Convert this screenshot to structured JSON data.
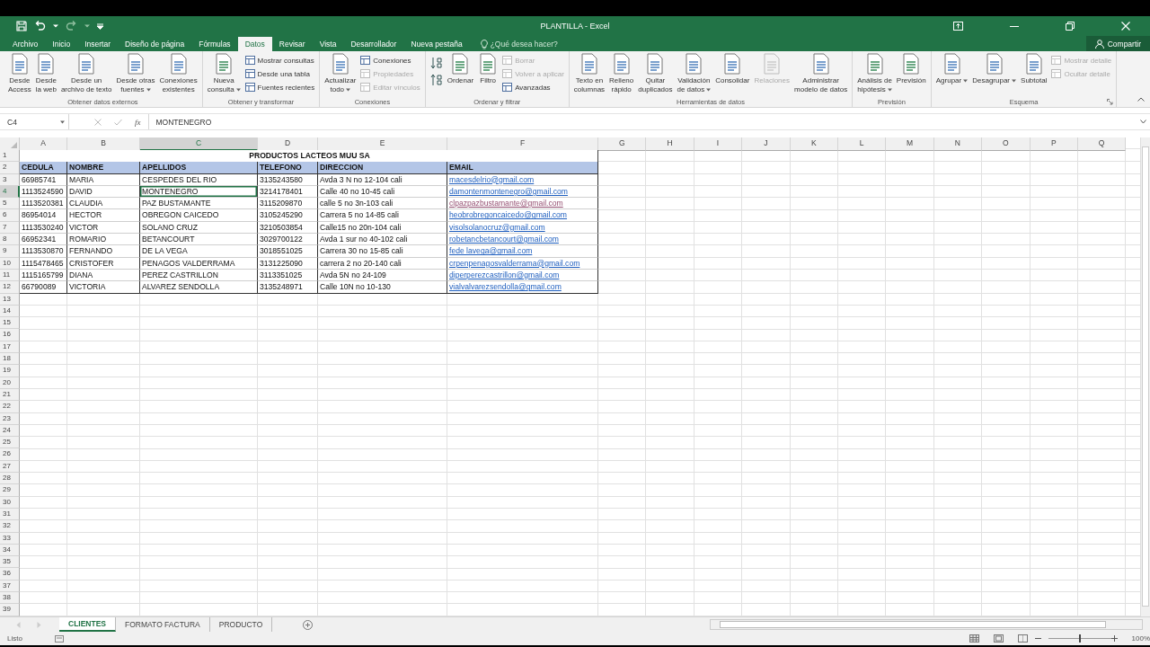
{
  "title_bar": {
    "title": "PLANTILLA - Excel"
  },
  "tabs": [
    {
      "label": "Archivo",
      "selected": false
    },
    {
      "label": "Inicio",
      "selected": false
    },
    {
      "label": "Insertar",
      "selected": false
    },
    {
      "label": "Diseño de página",
      "selected": false
    },
    {
      "label": "Fórmulas",
      "selected": false
    },
    {
      "label": "Datos",
      "selected": true
    },
    {
      "label": "Revisar",
      "selected": false
    },
    {
      "label": "Vista",
      "selected": false
    },
    {
      "label": "Desarrollador",
      "selected": false
    },
    {
      "label": "Nueva pestaña",
      "selected": false
    }
  ],
  "tell_me": {
    "placeholder": "¿Qué desea hacer?"
  },
  "share_button": "Compartir",
  "ribbon": {
    "groups": [
      {
        "label": "Obtener datos externos",
        "dialog_launcher": false,
        "items": [
          {
            "kind": "large",
            "label": "Desde\nAccess",
            "dropdown": false,
            "disabled": false
          },
          {
            "kind": "large",
            "label": "Desde\nla web",
            "dropdown": false,
            "disabled": false
          },
          {
            "kind": "large",
            "label": "Desde un\narchivo de texto",
            "dropdown": false,
            "disabled": false
          },
          {
            "kind": "large",
            "label": "Desde otras\nfuentes",
            "dropdown": true,
            "disabled": false
          },
          {
            "kind": "large",
            "label": "Conexiones\nexistentes",
            "dropdown": false,
            "disabled": false
          }
        ]
      },
      {
        "label": "Obtener y transformar",
        "dialog_launcher": false,
        "items": [
          {
            "kind": "large",
            "label": "Nueva\nconsulta",
            "dropdown": true,
            "disabled": false
          },
          {
            "kind": "stack",
            "items": [
              {
                "label": "Mostrar consultas",
                "disabled": false
              },
              {
                "label": "Desde una tabla",
                "disabled": false
              },
              {
                "label": "Fuentes recientes",
                "disabled": false
              }
            ]
          }
        ]
      },
      {
        "label": "Conexiones",
        "dialog_launcher": false,
        "items": [
          {
            "kind": "large",
            "label": "Actualizar\ntodo",
            "dropdown": true,
            "disabled": false
          },
          {
            "kind": "stack",
            "items": [
              {
                "label": "Conexiones",
                "disabled": false
              },
              {
                "label": "Propiedades",
                "disabled": true
              },
              {
                "label": "Editar vínculos",
                "disabled": true
              }
            ]
          }
        ]
      },
      {
        "label": "Ordenar y filtrar",
        "dialog_launcher": false,
        "items": [
          {
            "kind": "sort-icons"
          },
          {
            "kind": "large",
            "label": "Ordenar",
            "dropdown": false,
            "disabled": false
          },
          {
            "kind": "large",
            "label": "Filtro",
            "dropdown": false,
            "disabled": false
          },
          {
            "kind": "stack",
            "items": [
              {
                "label": "Borrar",
                "disabled": true
              },
              {
                "label": "Volver a aplicar",
                "disabled": true
              },
              {
                "label": "Avanzadas",
                "disabled": false
              }
            ]
          }
        ]
      },
      {
        "label": "Herramientas de datos",
        "dialog_launcher": false,
        "items": [
          {
            "kind": "large",
            "label": "Texto en\ncolumnas",
            "dropdown": false,
            "disabled": false
          },
          {
            "kind": "large",
            "label": "Relleno\nrápido",
            "dropdown": false,
            "disabled": false
          },
          {
            "kind": "large",
            "label": "Quitar\nduplicados",
            "dropdown": false,
            "disabled": false
          },
          {
            "kind": "large",
            "label": "Validación\nde datos",
            "dropdown": true,
            "disabled": false
          },
          {
            "kind": "large",
            "label": "Consolidar",
            "dropdown": false,
            "disabled": false
          },
          {
            "kind": "large",
            "label": "Relaciones",
            "dropdown": false,
            "disabled": true
          },
          {
            "kind": "large",
            "label": "Administrar\nmodelo de datos",
            "dropdown": false,
            "disabled": false
          }
        ]
      },
      {
        "label": "Previsión",
        "dialog_launcher": false,
        "items": [
          {
            "kind": "large",
            "label": "Análisis de\nhipótesis",
            "dropdown": true,
            "disabled": false
          },
          {
            "kind": "large",
            "label": "Previsión",
            "dropdown": false,
            "disabled": false
          }
        ]
      },
      {
        "label": "Esquema",
        "dialog_launcher": true,
        "items": [
          {
            "kind": "large",
            "label": "Agrupar",
            "dropdown": true,
            "disabled": false
          },
          {
            "kind": "large",
            "label": "Desagrupar",
            "dropdown": true,
            "disabled": false
          },
          {
            "kind": "large",
            "label": "Subtotal",
            "dropdown": false,
            "disabled": false
          },
          {
            "kind": "stack",
            "items": [
              {
                "label": "Mostrar detalle",
                "disabled": true
              },
              {
                "label": "Ocultar detalle",
                "disabled": true
              }
            ]
          }
        ]
      }
    ]
  },
  "formula_bar": {
    "name_box": "C4",
    "function_label": "fx",
    "value": "MONTENEGRO"
  },
  "sheet": {
    "column_headers": [
      {
        "label": "A",
        "selected": false
      },
      {
        "label": "B",
        "selected": false
      },
      {
        "label": "C",
        "selected": true
      },
      {
        "label": "D",
        "selected": false
      },
      {
        "label": "E",
        "selected": false
      },
      {
        "label": "F",
        "selected": false
      },
      {
        "label": "G",
        "selected": false
      },
      {
        "label": "H",
        "selected": false
      },
      {
        "label": "I",
        "selected": false
      },
      {
        "label": "J",
        "selected": false
      },
      {
        "label": "K",
        "selected": false
      },
      {
        "label": "L",
        "selected": false
      },
      {
        "label": "M",
        "selected": false
      },
      {
        "label": "N",
        "selected": false
      },
      {
        "label": "O",
        "selected": false
      },
      {
        "label": "P",
        "selected": false
      },
      {
        "label": "Q",
        "selected": false
      }
    ],
    "row_headers": [
      {
        "label": "1",
        "selected": false
      },
      {
        "label": "2",
        "selected": false
      },
      {
        "label": "3",
        "selected": false
      },
      {
        "label": "4",
        "selected": true
      },
      {
        "label": "5",
        "selected": false
      },
      {
        "label": "6",
        "selected": false
      },
      {
        "label": "7",
        "selected": false
      },
      {
        "label": "8",
        "selected": false
      },
      {
        "label": "9",
        "selected": false
      },
      {
        "label": "10",
        "selected": false
      },
      {
        "label": "11",
        "selected": false
      },
      {
        "label": "12",
        "selected": false
      },
      {
        "label": "13",
        "selected": false
      },
      {
        "label": "14",
        "selected": false
      },
      {
        "label": "15",
        "selected": false
      },
      {
        "label": "16",
        "selected": false
      },
      {
        "label": "17",
        "selected": false
      },
      {
        "label": "18",
        "selected": false
      },
      {
        "label": "19",
        "selected": false
      },
      {
        "label": "20",
        "selected": false
      },
      {
        "label": "21",
        "selected": false
      },
      {
        "label": "22",
        "selected": false
      },
      {
        "label": "23",
        "selected": false
      },
      {
        "label": "24",
        "selected": false
      },
      {
        "label": "25",
        "selected": false
      },
      {
        "label": "26",
        "selected": false
      },
      {
        "label": "27",
        "selected": false
      },
      {
        "label": "28",
        "selected": false
      },
      {
        "label": "29",
        "selected": false
      },
      {
        "label": "30",
        "selected": false
      },
      {
        "label": "31",
        "selected": false
      },
      {
        "label": "32",
        "selected": false
      },
      {
        "label": "33",
        "selected": false
      },
      {
        "label": "34",
        "selected": false
      },
      {
        "label": "35",
        "selected": false
      },
      {
        "label": "36",
        "selected": false
      },
      {
        "label": "37",
        "selected": false
      },
      {
        "label": "38",
        "selected": false
      },
      {
        "label": "39",
        "selected": false
      }
    ],
    "title": "PRODUCTOS LACTEOS MUU SA",
    "header": [
      "CEDULA",
      "NOMBRE",
      "APELLIDOS",
      "TELEFONO",
      "DIRECCION",
      "EMAIL"
    ],
    "rows": [
      {
        "cells": [
          "66985741",
          "MARIA",
          "CESPEDES DEL RIO",
          "3135243580",
          "Avda 3 N no 12-104 cali",
          "macesdelrio@gmail.com"
        ],
        "email_visited": false
      },
      {
        "cells": [
          "1113524590",
          "DAVID",
          "MONTENEGRO",
          "3214178401",
          "Calle 40 no 10-45 cali",
          "damontenmontenegro@gmail.com"
        ],
        "email_visited": false
      },
      {
        "cells": [
          "1113520381",
          "CLAUDIA",
          "PAZ BUSTAMANTE",
          "3115209870",
          "calle 5 no 3n-103 cali",
          "clpazpazbustamante@gmail.com"
        ],
        "email_visited": true
      },
      {
        "cells": [
          "86954014",
          "HECTOR",
          "OBREGON CAICEDO",
          "3105245290",
          "Carrera 5 no 14-85 cali",
          "heobrobregoncaicedo@gmail.com"
        ],
        "email_visited": false
      },
      {
        "cells": [
          "1113530240",
          "VICTOR",
          "SOLANO CRUZ",
          "3210503854",
          "Calle15 no 20n-104 cali",
          "visolsolanocruz@gmail.com"
        ],
        "email_visited": false
      },
      {
        "cells": [
          "66952341",
          "ROMARIO",
          "BETANCOURT",
          "3029700122",
          "Avda 1 sur no 40-102 cali",
          "robetancbetancourt@gmail.com"
        ],
        "email_visited": false
      },
      {
        "cells": [
          "1113530870",
          "FERNANDO",
          "DE LA VEGA",
          "3018551025",
          "Carrera 30 no 15-85 cali",
          "fede lavega@gmail.com"
        ],
        "email_visited": false
      },
      {
        "cells": [
          "1115478465",
          "CRISTOFER",
          "PENAGOS VALDERRAMA",
          "3131225090",
          "carrera 2 no 20-140 cali",
          "crpenpenagosvalderrama@gmail.com"
        ],
        "email_visited": false
      },
      {
        "cells": [
          "1115165799",
          "DIANA",
          "PEREZ CASTRILLON",
          "3113351025",
          "Avda 5N no 24-109",
          "diperperezcastrillon@gmail.com"
        ],
        "email_visited": false
      },
      {
        "cells": [
          "66790089",
          "VICTORIA",
          "ALVAREZ SENDOLLA",
          "3135248971",
          "Calle 10N no 10-130",
          "vialvalvarezsendolla@gmail.com"
        ],
        "email_visited": false
      }
    ]
  },
  "sheet_tabs": [
    {
      "label": "CLIENTES",
      "selected": true
    },
    {
      "label": "FORMATO FACTURA",
      "selected": false
    },
    {
      "label": "PRODUCTO",
      "selected": false
    }
  ],
  "status_bar": {
    "status": "Listo",
    "zoom": {
      "level": 0.5,
      "reading": "100%"
    }
  }
}
